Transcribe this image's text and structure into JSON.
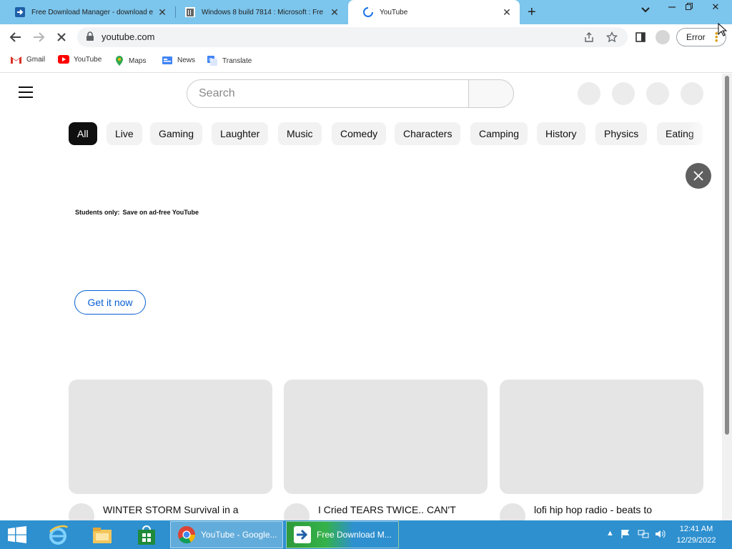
{
  "browser": {
    "tabs": [
      {
        "title": "Free Download Manager - download e",
        "active": false
      },
      {
        "title": "Windows 8 build 7814 : Microsoft : Fre",
        "active": false
      },
      {
        "title": "YouTube",
        "active": true
      }
    ],
    "url": "youtube.com",
    "error_label": "Error",
    "bookmarks": [
      "Gmail",
      "YouTube",
      "Maps",
      "News",
      "Translate"
    ]
  },
  "youtube": {
    "search_placeholder": "Search",
    "chips": [
      "All",
      "Live",
      "Gaming",
      "Laughter",
      "Music",
      "Comedy",
      "Characters",
      "Camping",
      "History",
      "Physics",
      "Eating"
    ],
    "promo": {
      "line1": "Students only:",
      "line2": "Save on ad-free YouTube",
      "cta": "Get it now"
    },
    "videos": [
      {
        "title": "WINTER STORM Survival in a"
      },
      {
        "title": "I Cried TEARS TWICE.. CAN'T"
      },
      {
        "title": "lofi hip hop radio - beats to"
      }
    ]
  },
  "taskbar": {
    "tasks": [
      "YouTube - Google...",
      "Free Download M..."
    ],
    "time": "12:41 AM",
    "date": "12/29/2022"
  },
  "colors": {
    "tabstrip": "#7cc5ec",
    "taskbar": "#2e90cf",
    "link_blue": "#065fd4"
  }
}
